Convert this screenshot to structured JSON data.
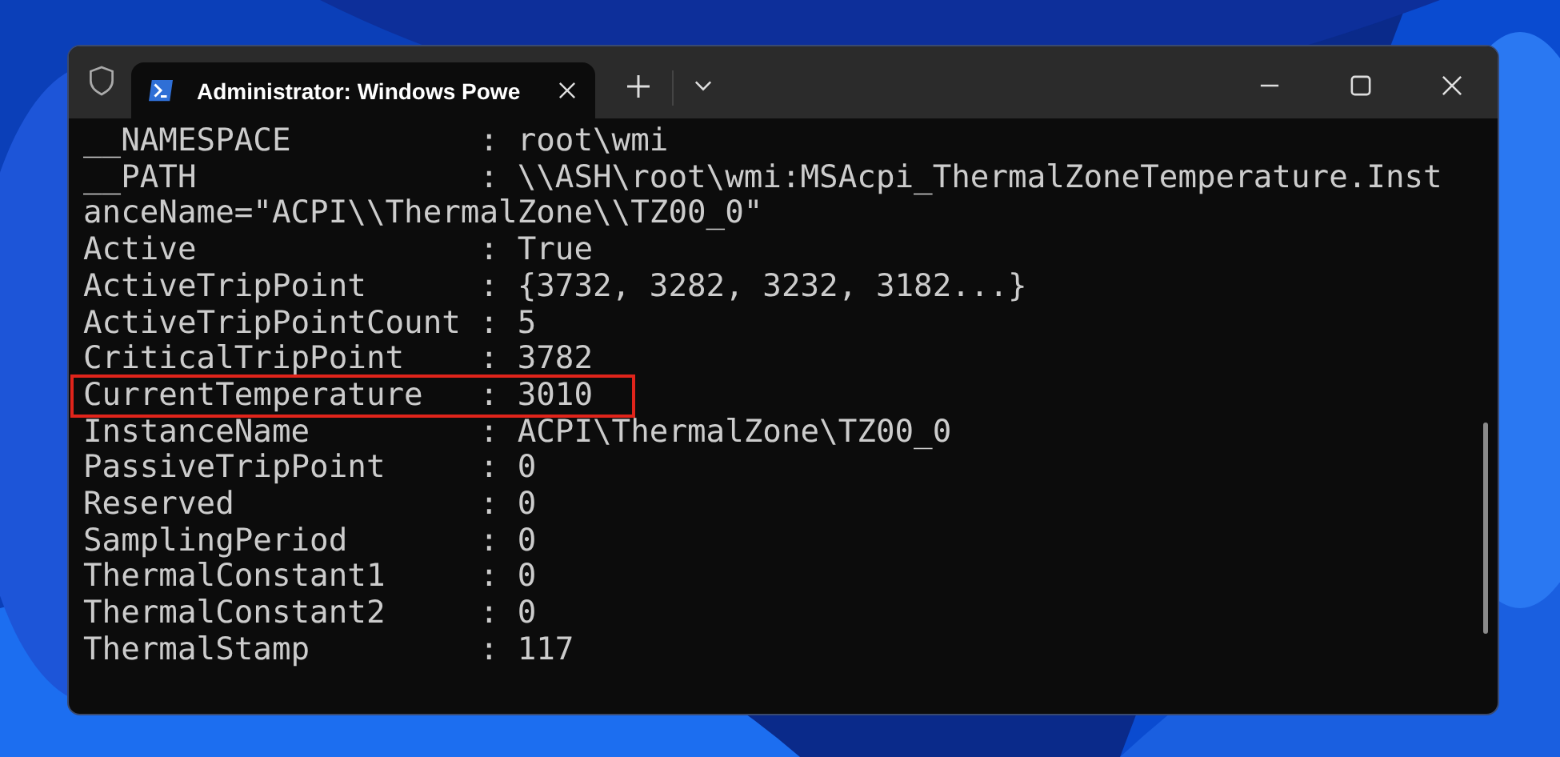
{
  "window": {
    "tab": {
      "title": "Administrator: Windows Powe",
      "selected": true
    }
  },
  "terminal": {
    "lines": [
      {
        "text": "__NAMESPACE          : root\\wmi",
        "highlighted": false
      },
      {
        "text": "__PATH               : \\\\ASH\\root\\wmi:MSAcpi_ThermalZoneTemperature.Inst",
        "highlighted": false
      },
      {
        "text": "anceName=\"ACPI\\\\ThermalZone\\\\TZ00_0\"",
        "highlighted": false
      },
      {
        "text": "Active               : True",
        "highlighted": false
      },
      {
        "text": "ActiveTripPoint      : {3732, 3282, 3232, 3182...}",
        "highlighted": false
      },
      {
        "text": "ActiveTripPointCount : 5",
        "highlighted": false
      },
      {
        "text": "CriticalTripPoint    : 3782",
        "highlighted": false
      },
      {
        "text": "CurrentTemperature   : 3010",
        "highlighted": true
      },
      {
        "text": "InstanceName         : ACPI\\ThermalZone\\TZ00_0",
        "highlighted": false
      },
      {
        "text": "PassiveTripPoint     : 0",
        "highlighted": false
      },
      {
        "text": "Reserved             : 0",
        "highlighted": false
      },
      {
        "text": "SamplingPeriod       : 0",
        "highlighted": false
      },
      {
        "text": "ThermalConstant1     : 0",
        "highlighted": false
      },
      {
        "text": "ThermalConstant2     : 0",
        "highlighted": false
      },
      {
        "text": "ThermalStamp         : 117",
        "highlighted": false
      }
    ]
  }
}
